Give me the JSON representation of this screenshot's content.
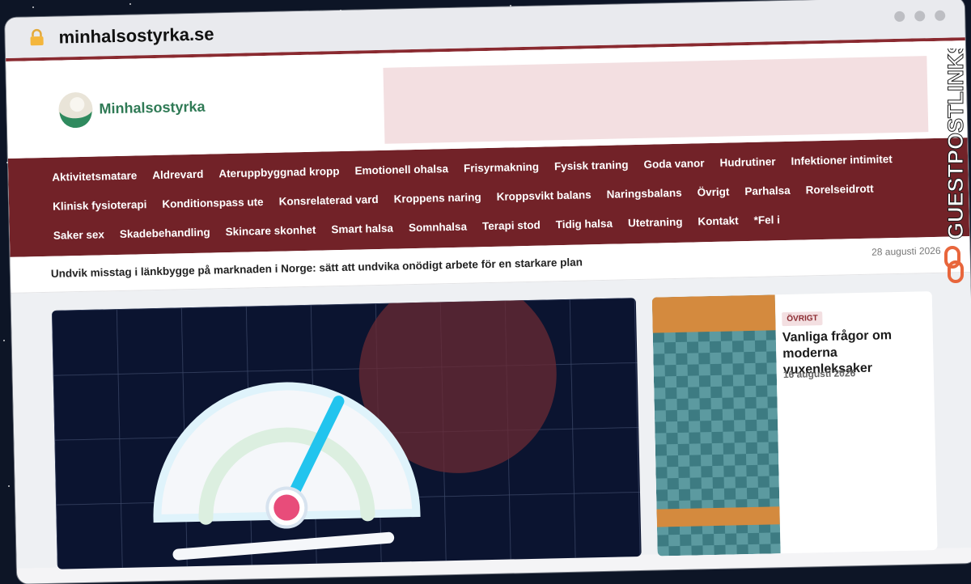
{
  "browser": {
    "url": "minhalsostyrka.se"
  },
  "site": {
    "logo_text": "Minhalsostyrka"
  },
  "nav": {
    "items": [
      "Aktivitetsmatare",
      "Aldrevard",
      "Ateruppbyggnad kropp",
      "Emotionell ohalsa",
      "Frisyrmakning",
      "Fysisk traning",
      "Goda vanor",
      "Hudrutiner",
      "Infektioner intimitet",
      "Klinisk fysioterapi",
      "Konditionspass ute",
      "Konsrelaterad vard",
      "Kroppens naring",
      "Kroppsvikt balans",
      "Naringsbalans",
      "Övrigt",
      "Parhalsa",
      "Rorelseidrott",
      "Saker sex",
      "Skadebehandling",
      "Skincare skonhet",
      "Smart halsa",
      "Somnhalsa",
      "Terapi stod",
      "Tidig halsa",
      "Utetraning",
      "Kontakt",
      "*Fel i"
    ]
  },
  "ticker": {
    "title": "Undvik misstag i länkbygge på marknaden i Norge: sätt att undvika onödigt arbete för en starkare plan",
    "date": "28 augusti 2026"
  },
  "featured_card": {
    "badge": "ÖVRIGT",
    "title": "Vanliga frågor om moderna vuxenleksaker",
    "date": "16 augusti 2026"
  },
  "watermark": {
    "text": "GUESTPOSTLINKS"
  },
  "colors": {
    "brand": "#722228",
    "accent_pink": "#f3dfe1",
    "logo_green": "#2f7a55",
    "gauge_needle": "#22c4ee",
    "gauge_hub": "#e84c7a",
    "watermark_orange": "#e8663c"
  },
  "icons": {
    "lock": "lock-icon",
    "window_controls": "window-dot-icon"
  }
}
